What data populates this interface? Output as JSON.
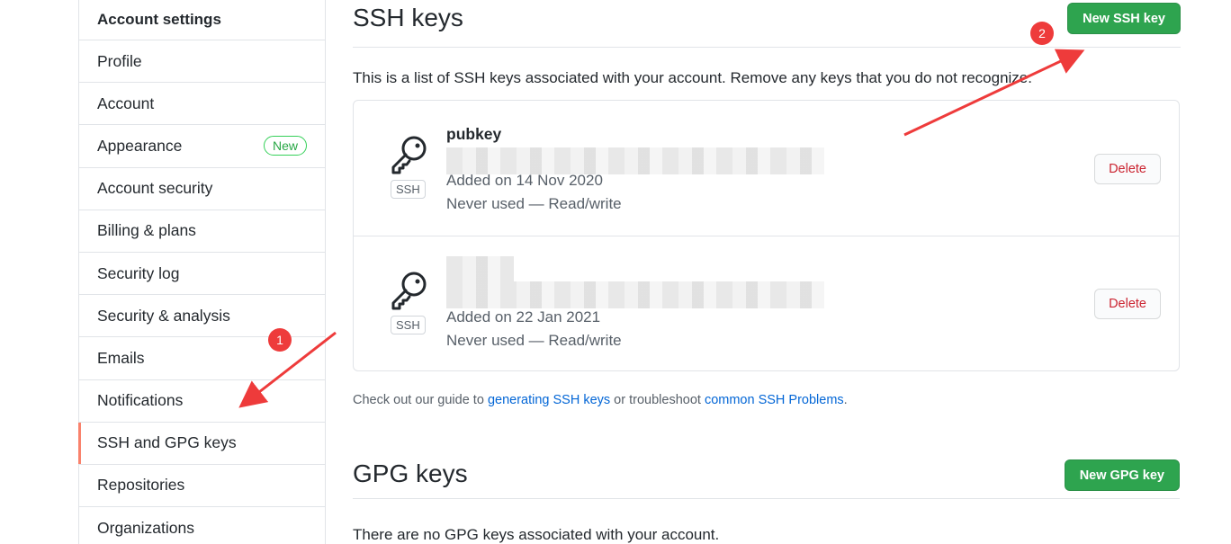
{
  "sidebar": {
    "header": "Account settings",
    "items": [
      {
        "label": "Profile"
      },
      {
        "label": "Account"
      },
      {
        "label": "Appearance",
        "badge": "New"
      },
      {
        "label": "Account security"
      },
      {
        "label": "Billing & plans"
      },
      {
        "label": "Security log"
      },
      {
        "label": "Security & analysis"
      },
      {
        "label": "Emails"
      },
      {
        "label": "Notifications"
      },
      {
        "label": "SSH and GPG keys",
        "selected": true
      },
      {
        "label": "Repositories"
      },
      {
        "label": "Organizations"
      }
    ]
  },
  "ssh": {
    "title": "SSH keys",
    "new_button": "New SSH key",
    "description": "This is a list of SSH keys associated with your account. Remove any keys that you do not recognize.",
    "keys": [
      {
        "title": "pubkey",
        "added": "Added on 14 Nov 2020",
        "usage": "Never used — Read/write",
        "type_label": "SSH",
        "delete_label": "Delete"
      },
      {
        "title": "",
        "added": "Added on 22 Jan 2021",
        "usage": "Never used — Read/write",
        "type_label": "SSH",
        "delete_label": "Delete"
      }
    ],
    "guide": {
      "prefix": "Check out our guide to ",
      "link1": "generating SSH keys",
      "middle": " or troubleshoot ",
      "link2": "common SSH Problems",
      "suffix": "."
    }
  },
  "gpg": {
    "title": "GPG keys",
    "new_button": "New GPG key",
    "empty": "There are no GPG keys associated with your account."
  },
  "annotations": {
    "marker1": "1",
    "marker2": "2",
    "color": "#ee3b3b"
  },
  "icons": {
    "key": "key-icon"
  },
  "colors": {
    "accent_selected": "#f9826c",
    "primary_green": "#2ea44f",
    "danger": "#cb2431",
    "link": "#0366d6"
  }
}
